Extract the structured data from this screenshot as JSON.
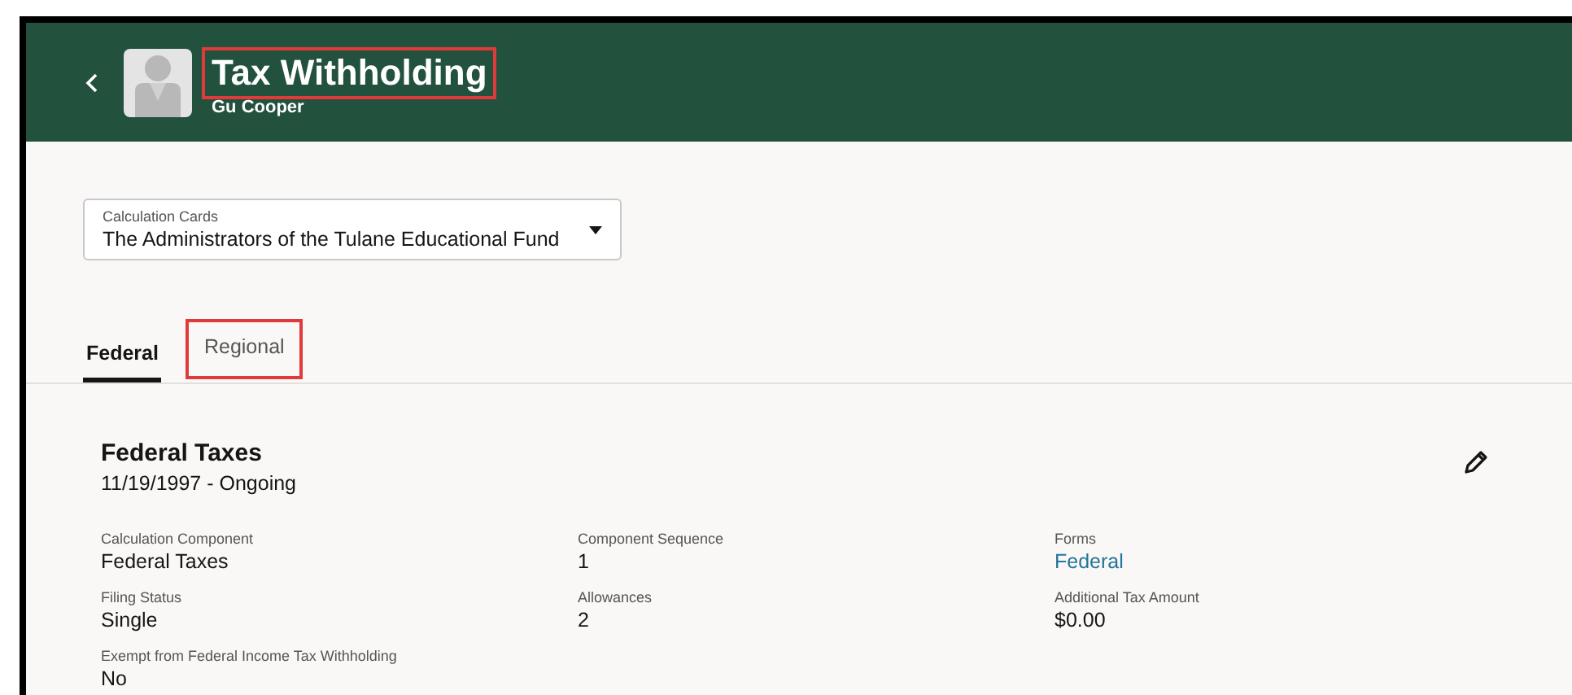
{
  "header": {
    "title": "Tax Withholding",
    "title_highlighted": true,
    "subtitle": "Gu Cooper"
  },
  "calculation_cards": {
    "label": "Calculation Cards",
    "value": "The Administrators of the Tulane Educational Fund"
  },
  "tabs": [
    {
      "label": "Federal",
      "selected": true,
      "highlighted": false
    },
    {
      "label": "Regional",
      "selected": false,
      "highlighted": true
    }
  ],
  "section": {
    "title": "Federal Taxes",
    "dates": "11/19/1997 - Ongoing",
    "fields": [
      {
        "label": "Calculation Component",
        "value": "Federal Taxes",
        "kind": "text"
      },
      {
        "label": "Component Sequence",
        "value": "1",
        "kind": "text"
      },
      {
        "label": "Forms",
        "value": "Federal",
        "kind": "link"
      },
      {
        "label": "Filing Status",
        "value": "Single",
        "kind": "text"
      },
      {
        "label": "Allowances",
        "value": "2",
        "kind": "text"
      },
      {
        "label": "Additional Tax Amount",
        "value": "$0.00",
        "kind": "text"
      },
      {
        "label": "Exempt from Federal Income Tax Withholding",
        "value": "No",
        "kind": "text"
      }
    ]
  }
}
